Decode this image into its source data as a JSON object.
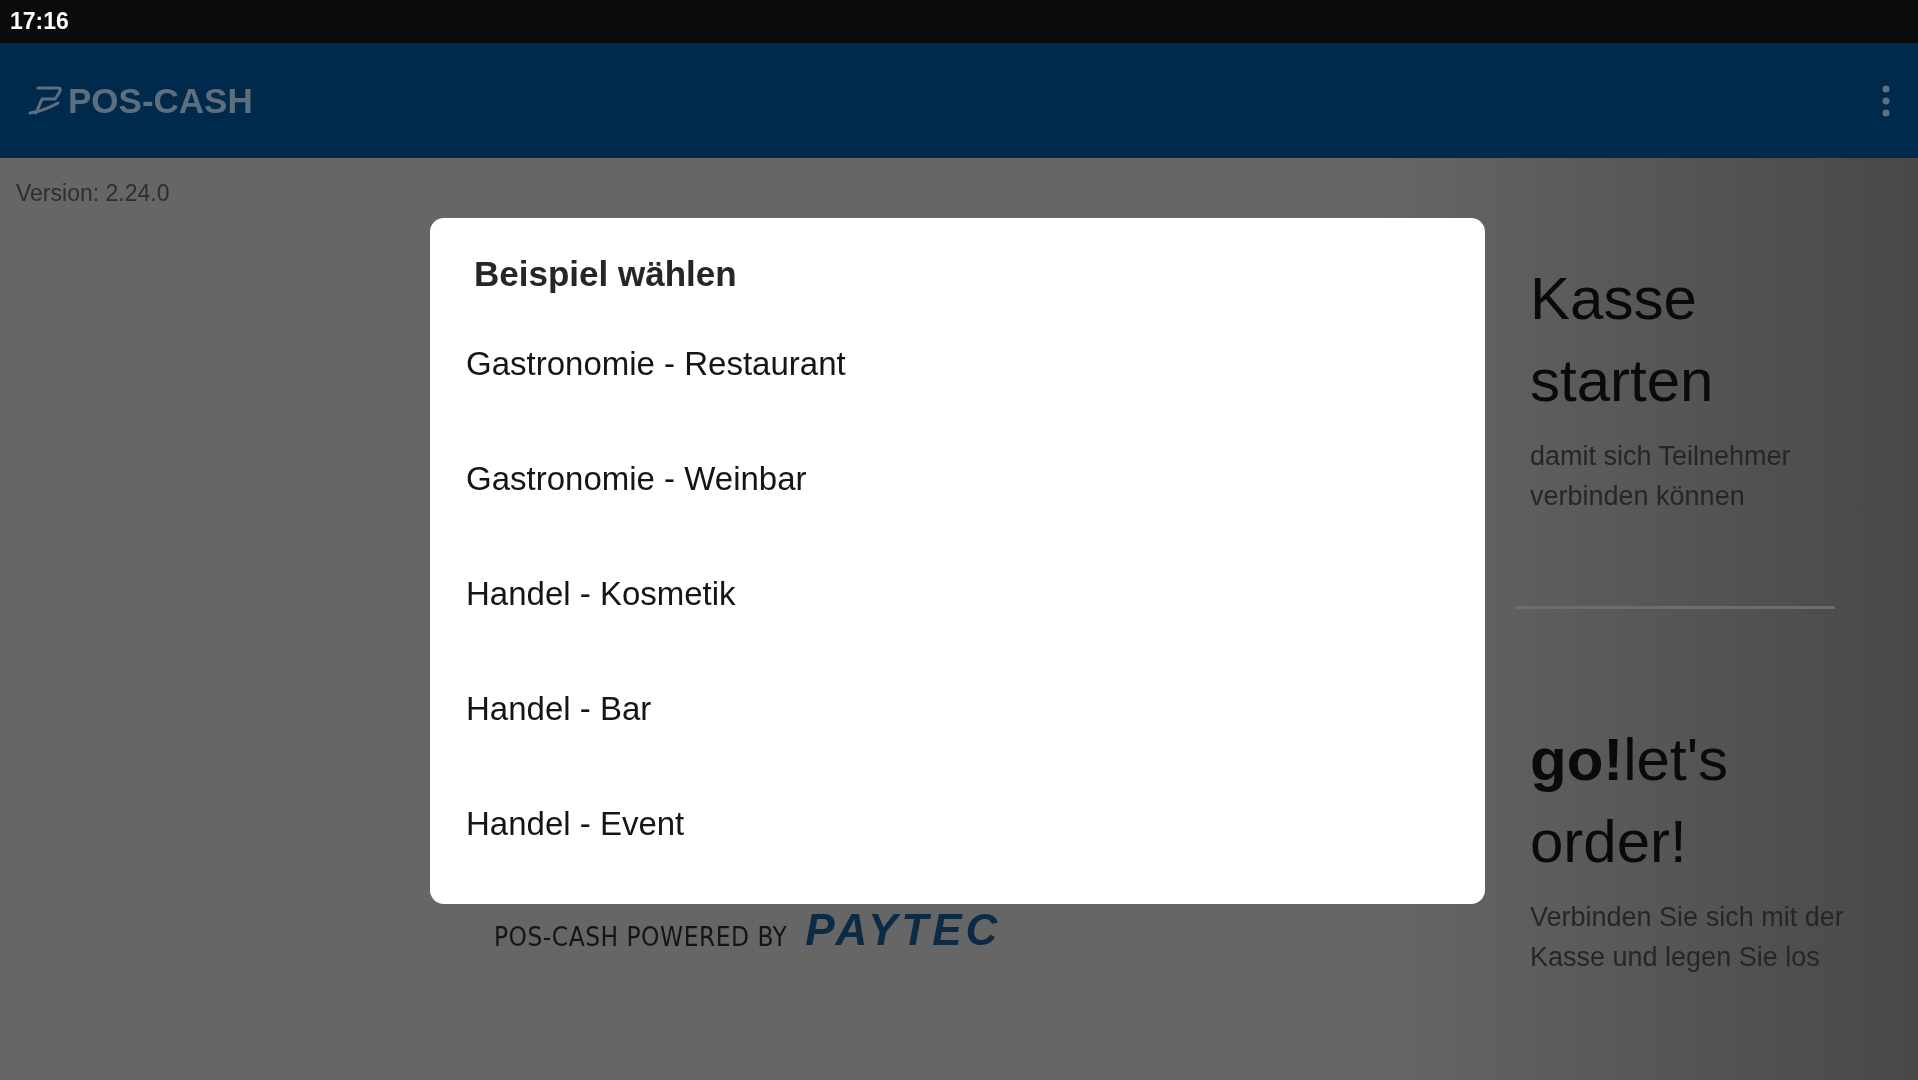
{
  "status_bar": {
    "time": "17:16"
  },
  "app_bar": {
    "title": "POS-CASH"
  },
  "version": "Version: 2.24.0",
  "footer": {
    "text": "POS-CASH POWERED BY",
    "logo": "PAYTEC"
  },
  "panels": [
    {
      "title": "Kasse starten",
      "subtitle": "damit sich Teilnehmer verbinden können"
    },
    {
      "title": "**go!**let's order!",
      "subtitle": "Verbinden Sie sich mit der Kasse und legen Sie los"
    }
  ],
  "dialog": {
    "title": "Beispiel wählen",
    "items": [
      "Gastronomie - Restaurant",
      "Gastronomie - Weinbar",
      "Handel - Kosmetik",
      "Handel - Bar",
      "Handel - Event"
    ]
  }
}
